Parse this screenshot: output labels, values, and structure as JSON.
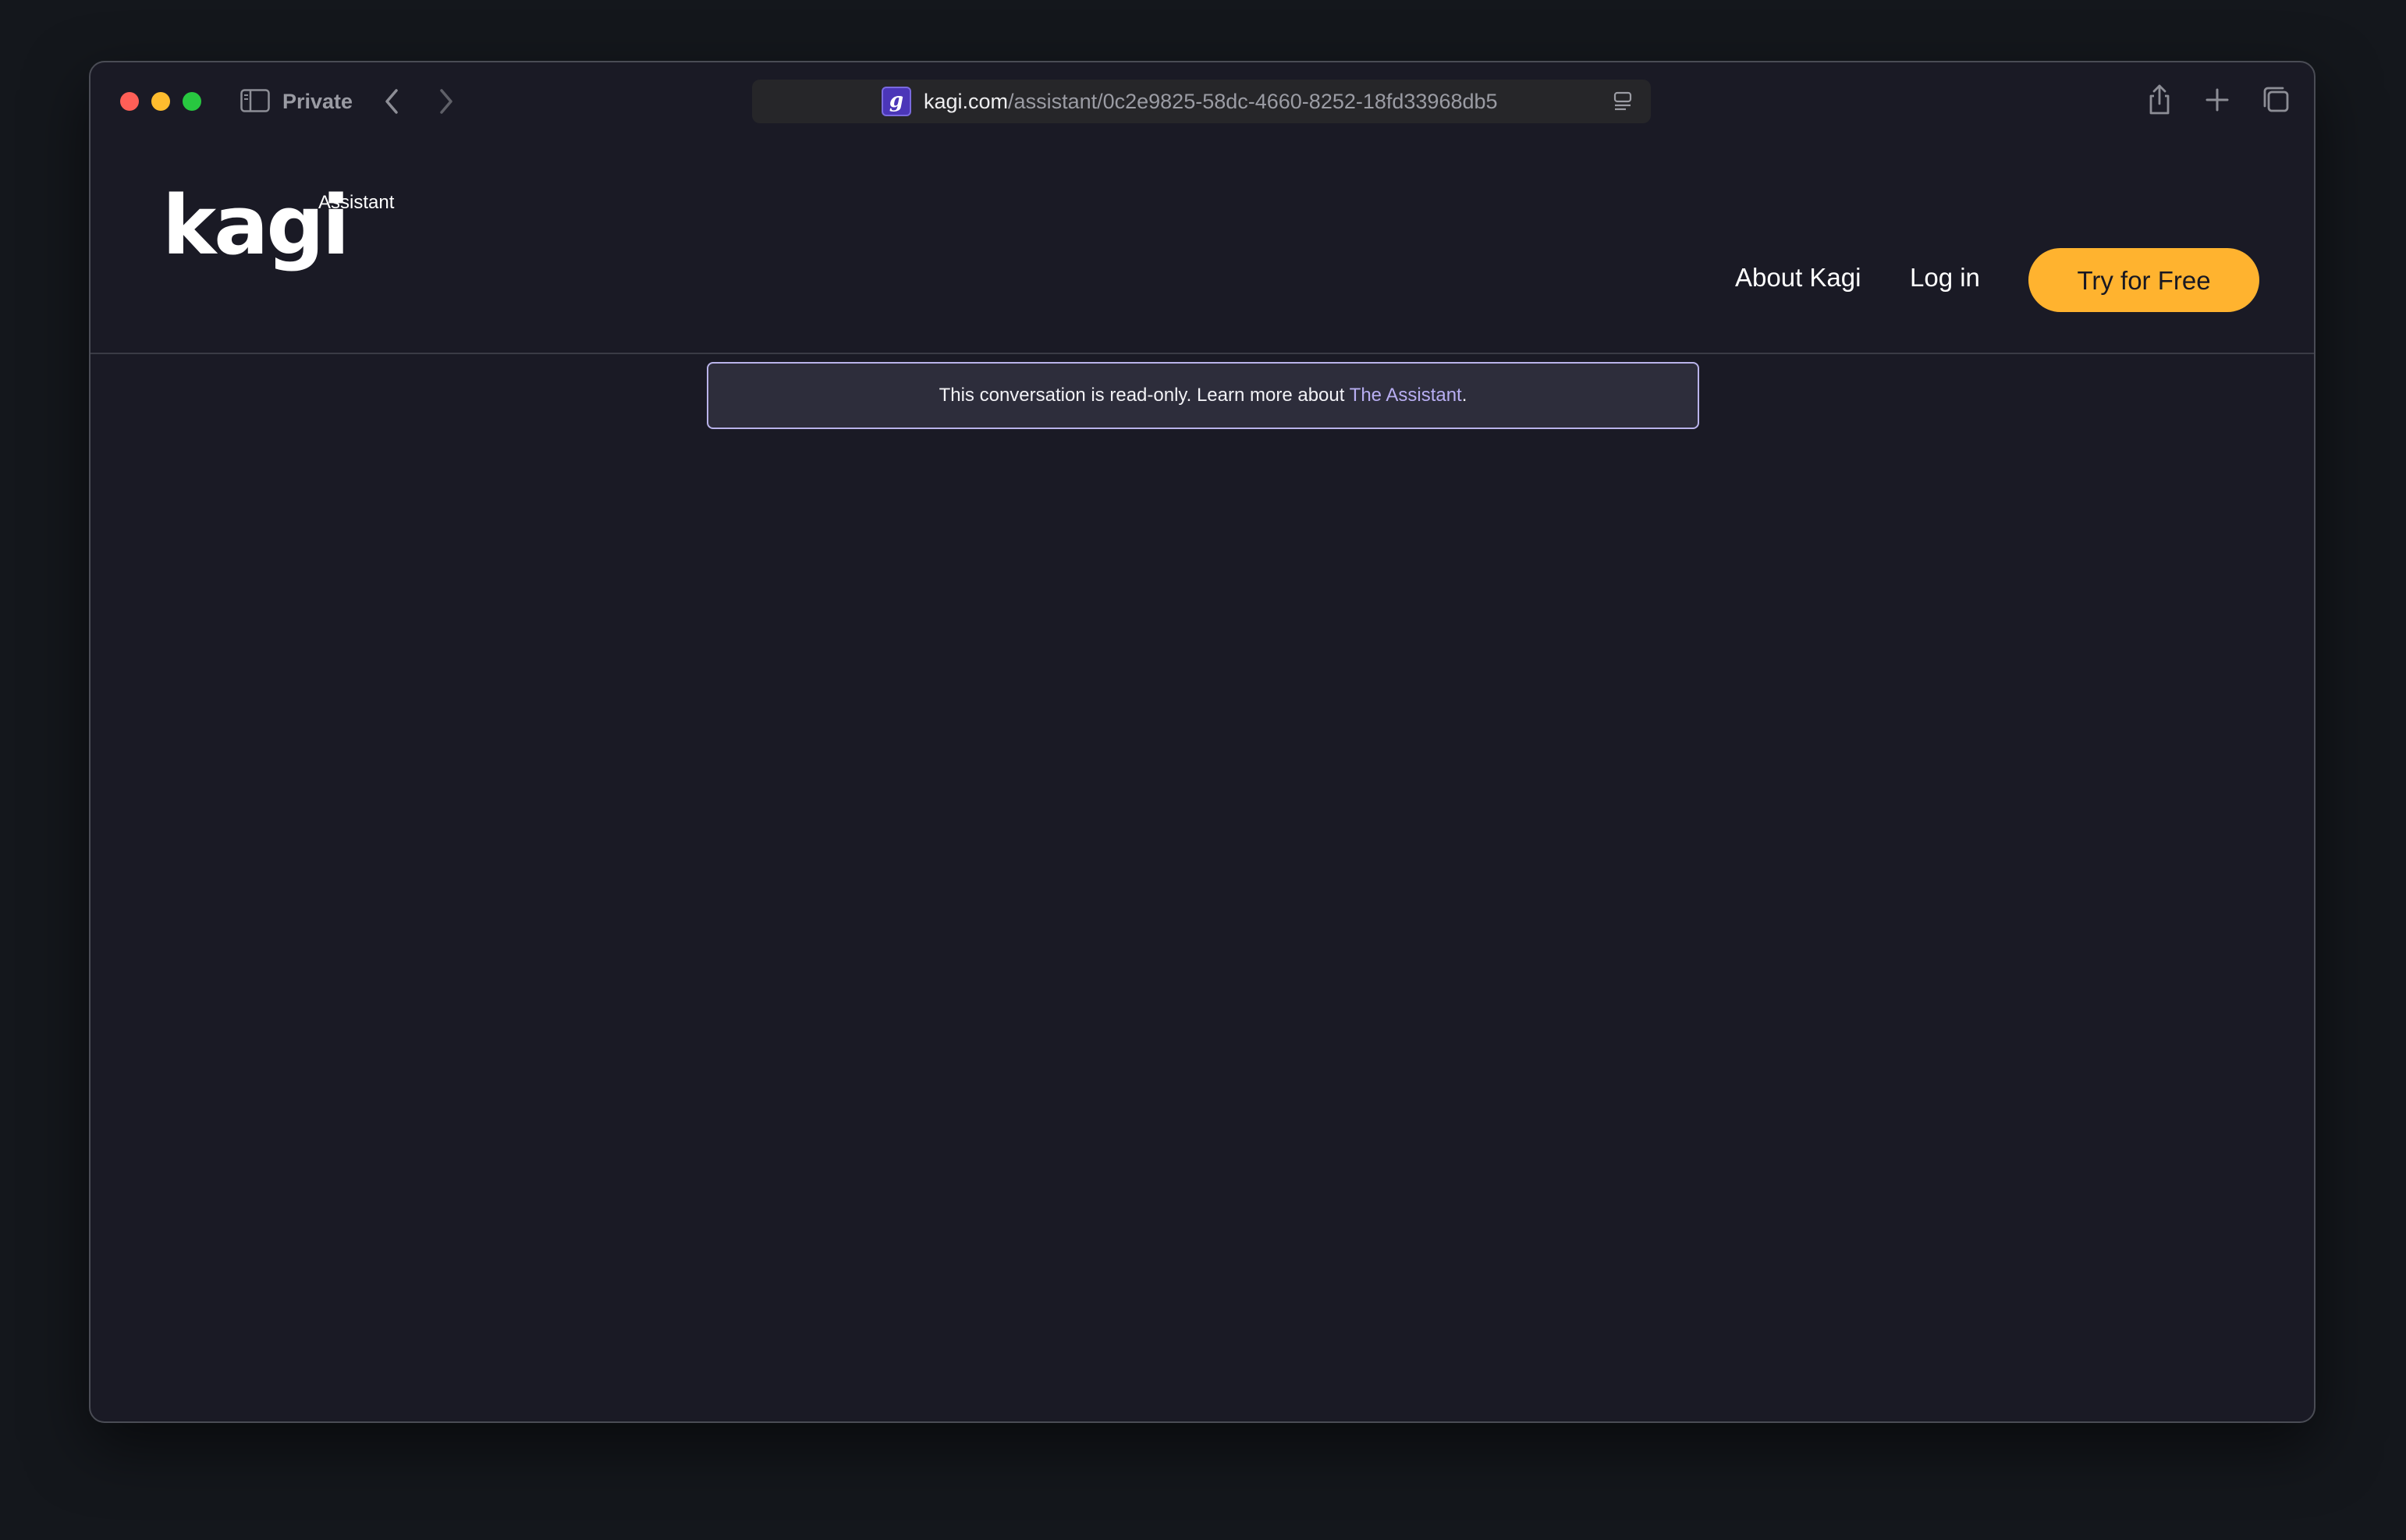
{
  "browser": {
    "private_label": "Private",
    "url_domain": "kagi.com",
    "url_path": "/assistant/0c2e9825-58dc-4660-8252-18fd33968db5",
    "favicon_letter": "g",
    "colors": {
      "close": "#fe5f57",
      "minimize": "#febc2e",
      "zoom": "#28c840"
    },
    "icons": [
      "sidebar-icon",
      "back-arrow-icon",
      "forward-arrow-icon",
      "reader-icon",
      "share-icon",
      "plus-icon",
      "tabs-icon"
    ]
  },
  "site": {
    "logo_word": "kagi",
    "logo_sub": "Assistant",
    "nav": {
      "about": "About Kagi",
      "login": "Log in",
      "cta": "Try for Free"
    },
    "colors": {
      "accent": "#ffb32f",
      "link": "#b8aef2",
      "background": "#1a1a25"
    }
  },
  "notice": {
    "text_before": "This conversation is read-only. Learn more about ",
    "link_text": "The Assistant",
    "text_after": "."
  }
}
